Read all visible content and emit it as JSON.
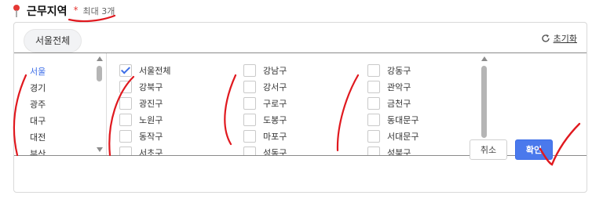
{
  "header": {
    "title": "근무지역",
    "required_mark": "*",
    "max_note": "최대 3개"
  },
  "selected_chip": "서울전체",
  "reset_label": "초기화",
  "regions": [
    {
      "label": "서울",
      "active": true
    },
    {
      "label": "경기",
      "active": false
    },
    {
      "label": "광주",
      "active": false
    },
    {
      "label": "대구",
      "active": false
    },
    {
      "label": "대전",
      "active": false
    },
    {
      "label": "부산",
      "active": false
    }
  ],
  "districts": {
    "col1": [
      {
        "label": "서울전체",
        "checked": true
      },
      {
        "label": "강북구",
        "checked": false
      },
      {
        "label": "광진구",
        "checked": false
      },
      {
        "label": "노원구",
        "checked": false
      },
      {
        "label": "동작구",
        "checked": false
      },
      {
        "label": "서초구",
        "checked": false
      }
    ],
    "col2": [
      {
        "label": "강남구",
        "checked": false
      },
      {
        "label": "강서구",
        "checked": false
      },
      {
        "label": "구로구",
        "checked": false
      },
      {
        "label": "도봉구",
        "checked": false
      },
      {
        "label": "마포구",
        "checked": false
      },
      {
        "label": "성동구",
        "checked": false
      }
    ],
    "col3": [
      {
        "label": "강동구",
        "checked": false
      },
      {
        "label": "관악구",
        "checked": false
      },
      {
        "label": "금천구",
        "checked": false
      },
      {
        "label": "동대문구",
        "checked": false
      },
      {
        "label": "서대문구",
        "checked": false
      },
      {
        "label": "성북구",
        "checked": false
      }
    ]
  },
  "buttons": {
    "cancel": "취소",
    "confirm": "확인"
  },
  "colors": {
    "accent": "#4a79ec",
    "required": "#e53935",
    "annotation": "#e0191f"
  },
  "icons": {
    "pin": "map-pin-icon",
    "reset": "refresh-icon"
  }
}
